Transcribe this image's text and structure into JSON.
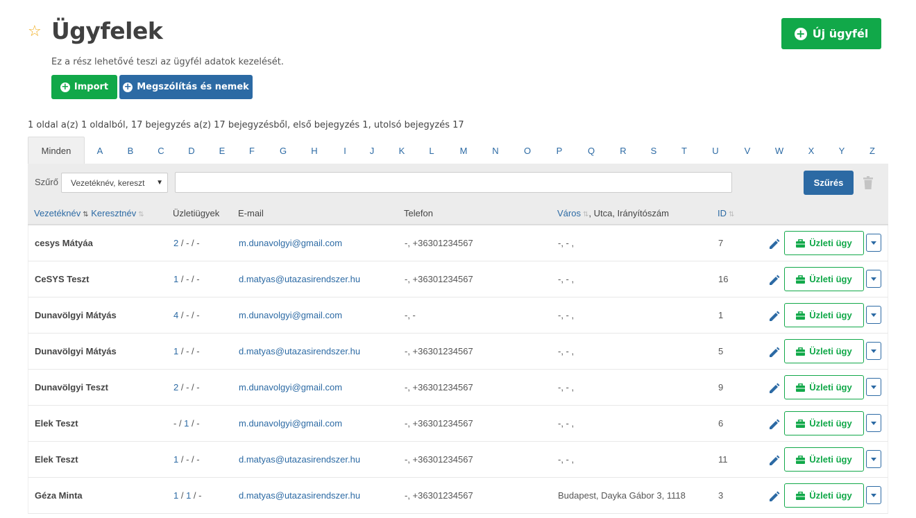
{
  "header": {
    "title": "Ügyfelek",
    "subtitle": "Ez a rész lehetővé teszi az ügyfél adatok kezelését.",
    "new_button": "Új ügyfél",
    "import_button": "Import",
    "salutation_button": "Megszólítás és nemek"
  },
  "pagination_info": "1 oldal a(z) 1 oldalból, 17 bejegyzés a(z) 17 bejegyzésből, első bejegyzés 1, utolsó bejegyzés 17",
  "alphabet": {
    "all_label": "Minden",
    "letters": [
      "A",
      "B",
      "C",
      "D",
      "E",
      "F",
      "G",
      "H",
      "I",
      "J",
      "K",
      "L",
      "M",
      "N",
      "O",
      "P",
      "Q",
      "R",
      "S",
      "T",
      "U",
      "V",
      "W",
      "X",
      "Y",
      "Z"
    ]
  },
  "filter": {
    "label": "Szűrő",
    "selected": "Vezetéknév, kereszt",
    "input_value": "",
    "button": "Szűrés"
  },
  "columns": {
    "lastname": "Vezetéknév",
    "firstname": "Keresztnév",
    "deals": "Üzletiügyek",
    "email": "E-mail",
    "phone": "Telefon",
    "city": "Város",
    "address_rest": ", Utca, Irányítószám",
    "id": "ID"
  },
  "row_action_label": "Üzleti ügy",
  "colors": {
    "green": "#11a849",
    "blue": "#2c6aa4"
  },
  "rows": [
    {
      "name": "cesys Mátyáa",
      "deals_link": "2",
      "deals_rest": " / - / -",
      "email": "m.dunavolgyi@gmail.com",
      "phone": "-, +36301234567",
      "city": "-, - ,",
      "id": "7"
    },
    {
      "name": "CeSYS Teszt",
      "deals_link": "1",
      "deals_rest": " / - / -",
      "email": "d.matyas@utazasirendszer.hu",
      "phone": "-, +36301234567",
      "city": "-, - ,",
      "id": "16"
    },
    {
      "name": "Dunavölgyi Mátyás",
      "deals_link": "4",
      "deals_rest": " / - / -",
      "email": "m.dunavolgyi@gmail.com",
      "phone": "-, -",
      "city": "-, - ,",
      "id": "1"
    },
    {
      "name": "Dunavölgyi Mátyás",
      "deals_link": "1",
      "deals_rest": " / - / -",
      "email": "d.matyas@utazasirendszer.hu",
      "phone": "-, +36301234567",
      "city": "-, - ,",
      "id": "5"
    },
    {
      "name": "Dunavölgyi Teszt",
      "deals_link": "2",
      "deals_rest": " / - / -",
      "email": "m.dunavolgyi@gmail.com",
      "phone": "-, +36301234567",
      "city": "-, - ,",
      "id": "9"
    },
    {
      "name": "Elek Teszt",
      "deals_pre": "- / ",
      "deals_link": "1",
      "deals_rest": " / -",
      "email": "m.dunavolgyi@gmail.com",
      "phone": "-, +36301234567",
      "city": "-, - ,",
      "id": "6"
    },
    {
      "name": "Elek Teszt",
      "deals_link": "1",
      "deals_rest": " / - / -",
      "email": "d.matyas@utazasirendszer.hu",
      "phone": "-, +36301234567",
      "city": "-, - ,",
      "id": "11"
    },
    {
      "name": "Géza Minta",
      "deals_link": "1",
      "deals_mid": " / ",
      "deals_link2": "1",
      "deals_rest": " / -",
      "email": "d.matyas@utazasirendszer.hu",
      "phone": "-, +36301234567",
      "city": "Budapest, Dayka Gábor 3, 1118",
      "id": "3"
    }
  ]
}
